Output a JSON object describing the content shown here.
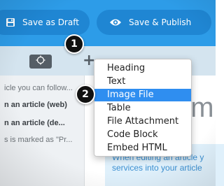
{
  "toolbar": {
    "save_draft_label": "Save as Draft",
    "save_publish_label": "Save & Publish",
    "save_draft_icon": "floppy-disk-icon",
    "save_publish_icon": "eye-icon"
  },
  "editor_toolbar": {
    "target_icon": "crosshair-icon",
    "insert_icon": "plus-icon",
    "insert_label": "+"
  },
  "sidebar": {
    "lines": [
      {
        "text": "icle you can follow..."
      },
      {
        "text": "n an article (web)"
      },
      {
        "text": "n an article (de..."
      },
      {
        "text": "s is marked as \"Pr..."
      }
    ]
  },
  "content": {
    "heading_fragment": "em",
    "hint_line1": "When editing an article y",
    "hint_line2": "services into your article"
  },
  "insert_menu": {
    "items": [
      {
        "label": "Heading"
      },
      {
        "label": "Text"
      },
      {
        "label": "Image File"
      },
      {
        "label": "Table"
      },
      {
        "label": "File Attachment"
      },
      {
        "label": "Code Block"
      },
      {
        "label": "Embed HTML"
      }
    ],
    "selected": "Image File"
  },
  "callouts": [
    {
      "label": "1"
    },
    {
      "label": "2"
    }
  ],
  "colors": {
    "topbar": "#2d9ce8",
    "selection": "#2f8ef0",
    "callout": "#111111"
  }
}
